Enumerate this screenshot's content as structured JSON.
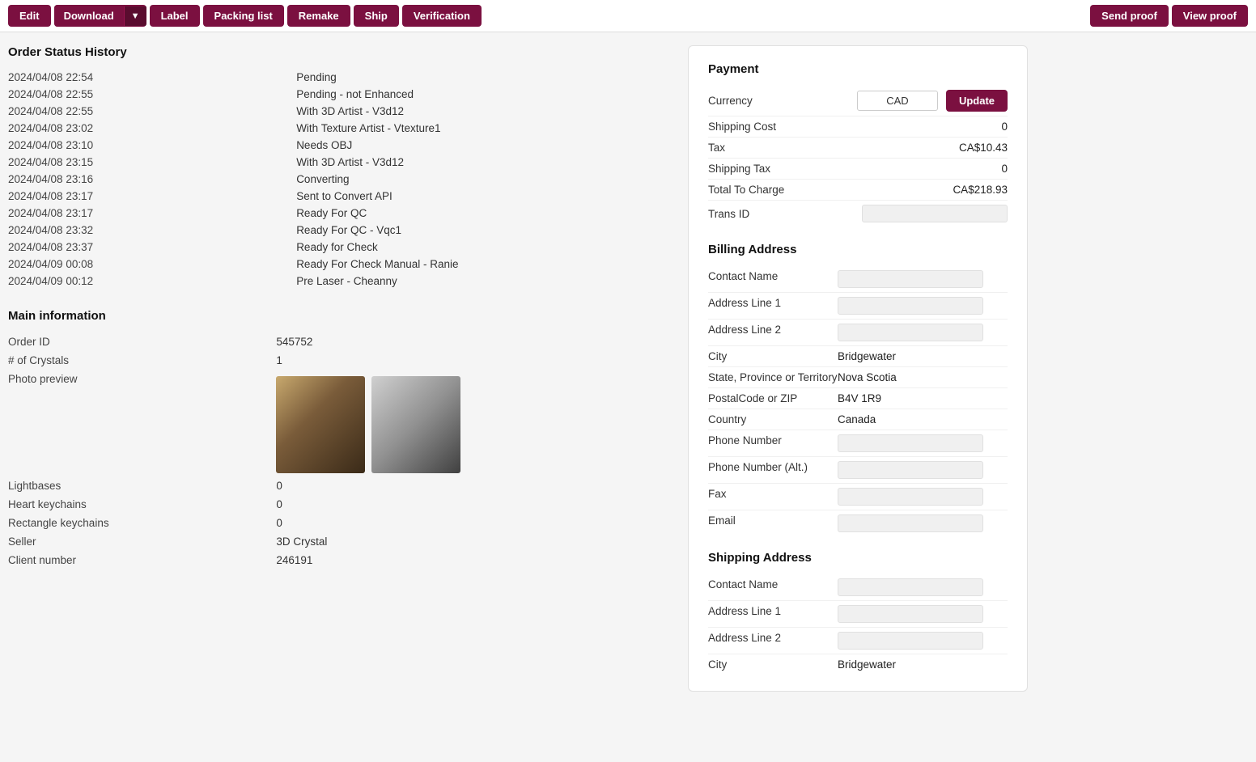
{
  "toolbar": {
    "edit_label": "Edit",
    "download_label": "Download",
    "label_label": "Label",
    "packing_list_label": "Packing list",
    "remake_label": "Remake",
    "ship_label": "Ship",
    "verification_label": "Verification",
    "send_proof_label": "Send proof",
    "view_proof_label": "View proof"
  },
  "order_status_history": {
    "title": "Order Status History",
    "entries": [
      {
        "timestamp": "2024/04/08 22:54",
        "status": "Pending"
      },
      {
        "timestamp": "2024/04/08 22:55",
        "status": "Pending - not Enhanced"
      },
      {
        "timestamp": "2024/04/08 22:55",
        "status": "With 3D Artist - V3d12"
      },
      {
        "timestamp": "2024/04/08 23:02",
        "status": "With Texture Artist - Vtexture1"
      },
      {
        "timestamp": "2024/04/08 23:10",
        "status": "Needs OBJ"
      },
      {
        "timestamp": "2024/04/08 23:15",
        "status": "With 3D Artist - V3d12"
      },
      {
        "timestamp": "2024/04/08 23:16",
        "status": "Converting"
      },
      {
        "timestamp": "2024/04/08 23:17",
        "status": "Sent to Convert API"
      },
      {
        "timestamp": "2024/04/08 23:17",
        "status": "Ready For QC"
      },
      {
        "timestamp": "2024/04/08 23:32",
        "status": "Ready For QC - Vqc1"
      },
      {
        "timestamp": "2024/04/08 23:37",
        "status": "Ready for Check"
      },
      {
        "timestamp": "2024/04/09 00:08",
        "status": "Ready For Check Manual - Ranie"
      },
      {
        "timestamp": "2024/04/09 00:12",
        "status": "Pre Laser - Cheanny"
      }
    ]
  },
  "main_information": {
    "title": "Main information",
    "order_id_label": "Order ID",
    "order_id_value": "545752",
    "crystals_label": "# of Crystals",
    "crystals_value": "1",
    "photo_preview_label": "Photo preview",
    "lightbases_label": "Lightbases",
    "lightbases_value": "0",
    "heart_keychains_label": "Heart keychains",
    "heart_keychains_value": "0",
    "rectangle_keychains_label": "Rectangle keychains",
    "rectangle_keychains_value": "0",
    "seller_label": "Seller",
    "seller_value": "3D Crystal",
    "client_number_label": "Client number",
    "client_number_value": "246191"
  },
  "payment": {
    "title": "Payment",
    "currency_label": "Currency",
    "currency_value": "CAD",
    "update_label": "Update",
    "shipping_cost_label": "Shipping Cost",
    "shipping_cost_value": "0",
    "tax_label": "Tax",
    "tax_value": "CA$10.43",
    "shipping_tax_label": "Shipping Tax",
    "shipping_tax_value": "0",
    "total_to_charge_label": "Total To Charge",
    "total_to_charge_value": "CA$218.93",
    "trans_id_label": "Trans ID",
    "trans_id_value": ""
  },
  "billing_address": {
    "title": "Billing Address",
    "contact_name_label": "Contact Name",
    "contact_name_value": "",
    "address_line1_label": "Address Line 1",
    "address_line1_value": "",
    "address_line2_label": "Address Line 2",
    "address_line2_value": "",
    "city_label": "City",
    "city_value": "Bridgewater",
    "state_label": "State, Province or Territory",
    "state_value": "Nova Scotia",
    "postal_label": "PostalCode or ZIP",
    "postal_value": "B4V 1R9",
    "country_label": "Country",
    "country_value": "Canada",
    "phone_label": "Phone Number",
    "phone_value": "",
    "phone_alt_label": "Phone Number (Alt.)",
    "phone_alt_value": "",
    "fax_label": "Fax",
    "fax_value": "",
    "email_label": "Email",
    "email_value": ""
  },
  "shipping_address": {
    "title": "Shipping Address",
    "contact_name_label": "Contact Name",
    "contact_name_value": "",
    "address_line1_label": "Address Line 1",
    "address_line1_value": "",
    "address_line2_label": "Address Line 2",
    "address_line2_value": "",
    "city_label": "City",
    "city_value": "Bridgewater"
  }
}
